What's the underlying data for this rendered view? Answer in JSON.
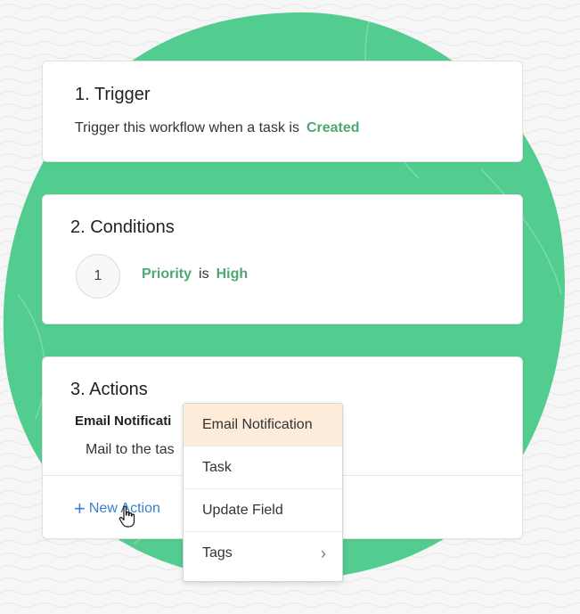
{
  "colors": {
    "accent_green": "#4fa871",
    "blob_green": "#52cc8f",
    "link_blue": "#3a7fd0",
    "menu_highlight": "#fdecd9"
  },
  "trigger": {
    "title": "1. Trigger",
    "sentence": "Trigger this workflow when a task is",
    "event": "Created"
  },
  "conditions": {
    "title": "2. Conditions",
    "items": [
      {
        "number": "1",
        "field": "Priority",
        "operator": "is",
        "value": "High"
      }
    ]
  },
  "actions": {
    "title": "3. Actions",
    "items": [
      {
        "name": "Email Notificati",
        "description": "Mail to the tas"
      }
    ],
    "new_action_label": "New Action",
    "new_action_icon": "plus-icon"
  },
  "dropdown_menu": {
    "items": [
      {
        "label": "Email Notification",
        "highlighted": true
      },
      {
        "label": "Task"
      },
      {
        "label": "Update Field"
      },
      {
        "label": "Tags",
        "has_submenu": true,
        "icon": "chevron-right-icon"
      }
    ]
  }
}
